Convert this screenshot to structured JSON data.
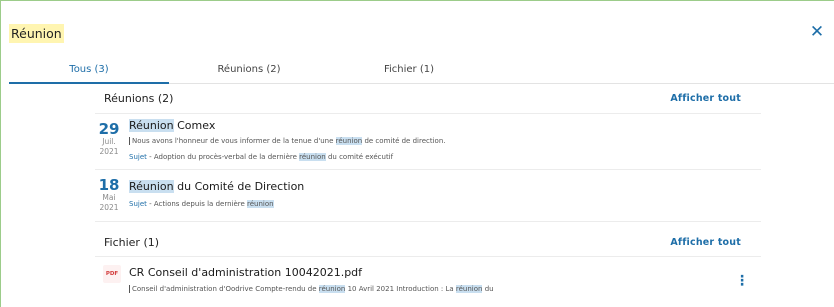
{
  "search": {
    "query": "Réunion",
    "close_icon": "close-icon"
  },
  "tabs": [
    {
      "label": "Tous (3)",
      "active": true
    },
    {
      "label": "Réunions (2)",
      "active": false
    },
    {
      "label": "Fichier (1)",
      "active": false
    }
  ],
  "meetings": {
    "title": "Réunions (2)",
    "see_all": "Afficher tout",
    "items": [
      {
        "day": "29",
        "month": "Juil.",
        "year": "2021",
        "title_hl": "Réunion",
        "title_rest": " Comex",
        "line1_a": "Nous avons l'honneur de vous informer de la tenue d'une ",
        "line1_hl": "réunion",
        "line1_b": " de comité de direction.",
        "sujet_label": "Sujet",
        "line2_a": " - Adoption du procès-verbal de la dernière ",
        "line2_hl": "réunion",
        "line2_b": " du comité exécutif"
      },
      {
        "day": "18",
        "month": "Mai",
        "year": "2021",
        "title_hl": "Réunion",
        "title_rest": " du Comité de Direction",
        "sujet_label": "Sujet",
        "line2_a": " - Actions depuis la dernière ",
        "line2_hl": "réunion",
        "line2_b": ""
      }
    ]
  },
  "files": {
    "title": "Fichier (1)",
    "see_all": "Afficher tout",
    "items": [
      {
        "badge": "PDF",
        "name": "CR Conseil d'administration 10042021.pdf",
        "snip_a": "Conseil d'administration d'Oodrive Compte-rendu de ",
        "snip_hl1": "réunion",
        "snip_b": " 10 Avril 2021 Introduction : La ",
        "snip_hl2": "réunion",
        "snip_c": " du",
        "more_icon": "more-vertical-icon"
      }
    ]
  },
  "colors": {
    "accent": "#1e6ea8",
    "query_highlight": "#fff5b1",
    "term_highlight": "#c9dff0",
    "pdf": "#d23b3b"
  }
}
